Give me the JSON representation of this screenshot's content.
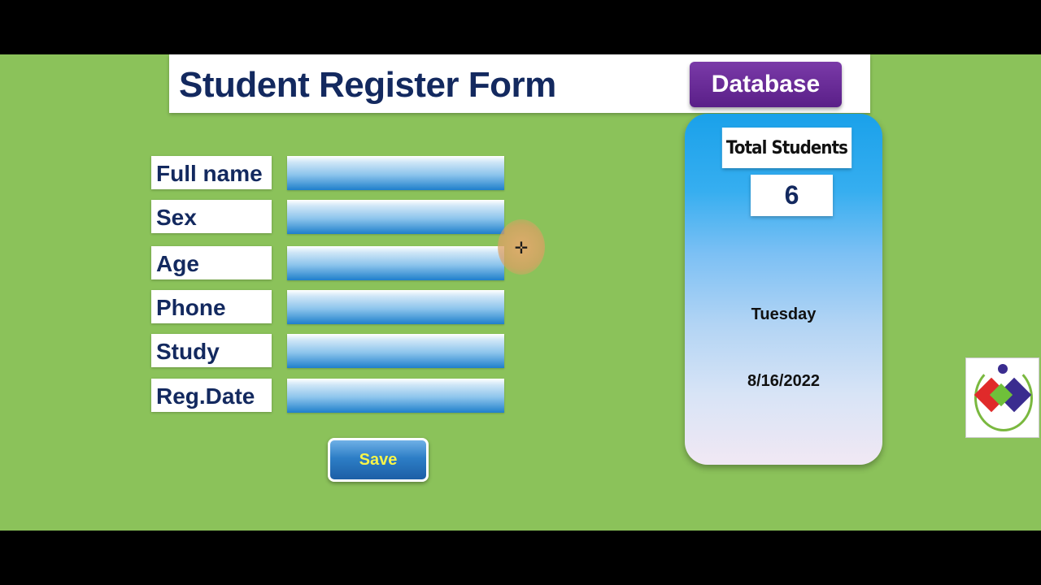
{
  "header": {
    "title": "Student Register Form",
    "database_button": "Database"
  },
  "form": {
    "fields": [
      {
        "label": "Full name",
        "value": ""
      },
      {
        "label": "Sex",
        "value": ""
      },
      {
        "label": "Age",
        "value": ""
      },
      {
        "label": "Phone",
        "value": ""
      },
      {
        "label": "Study",
        "value": ""
      },
      {
        "label": "Reg.Date",
        "value": ""
      }
    ],
    "save_label": "Save"
  },
  "stats": {
    "header": "Total Students",
    "count": "6",
    "day": "Tuesday",
    "date": "8/16/2022"
  },
  "colors": {
    "background": "#8bc25a",
    "title_text": "#13295f",
    "database_button": "#6b2d9a",
    "save_text": "#f7f44a"
  },
  "icons": {
    "cursor": "move-cursor-icon",
    "brand": "brand-logo"
  }
}
